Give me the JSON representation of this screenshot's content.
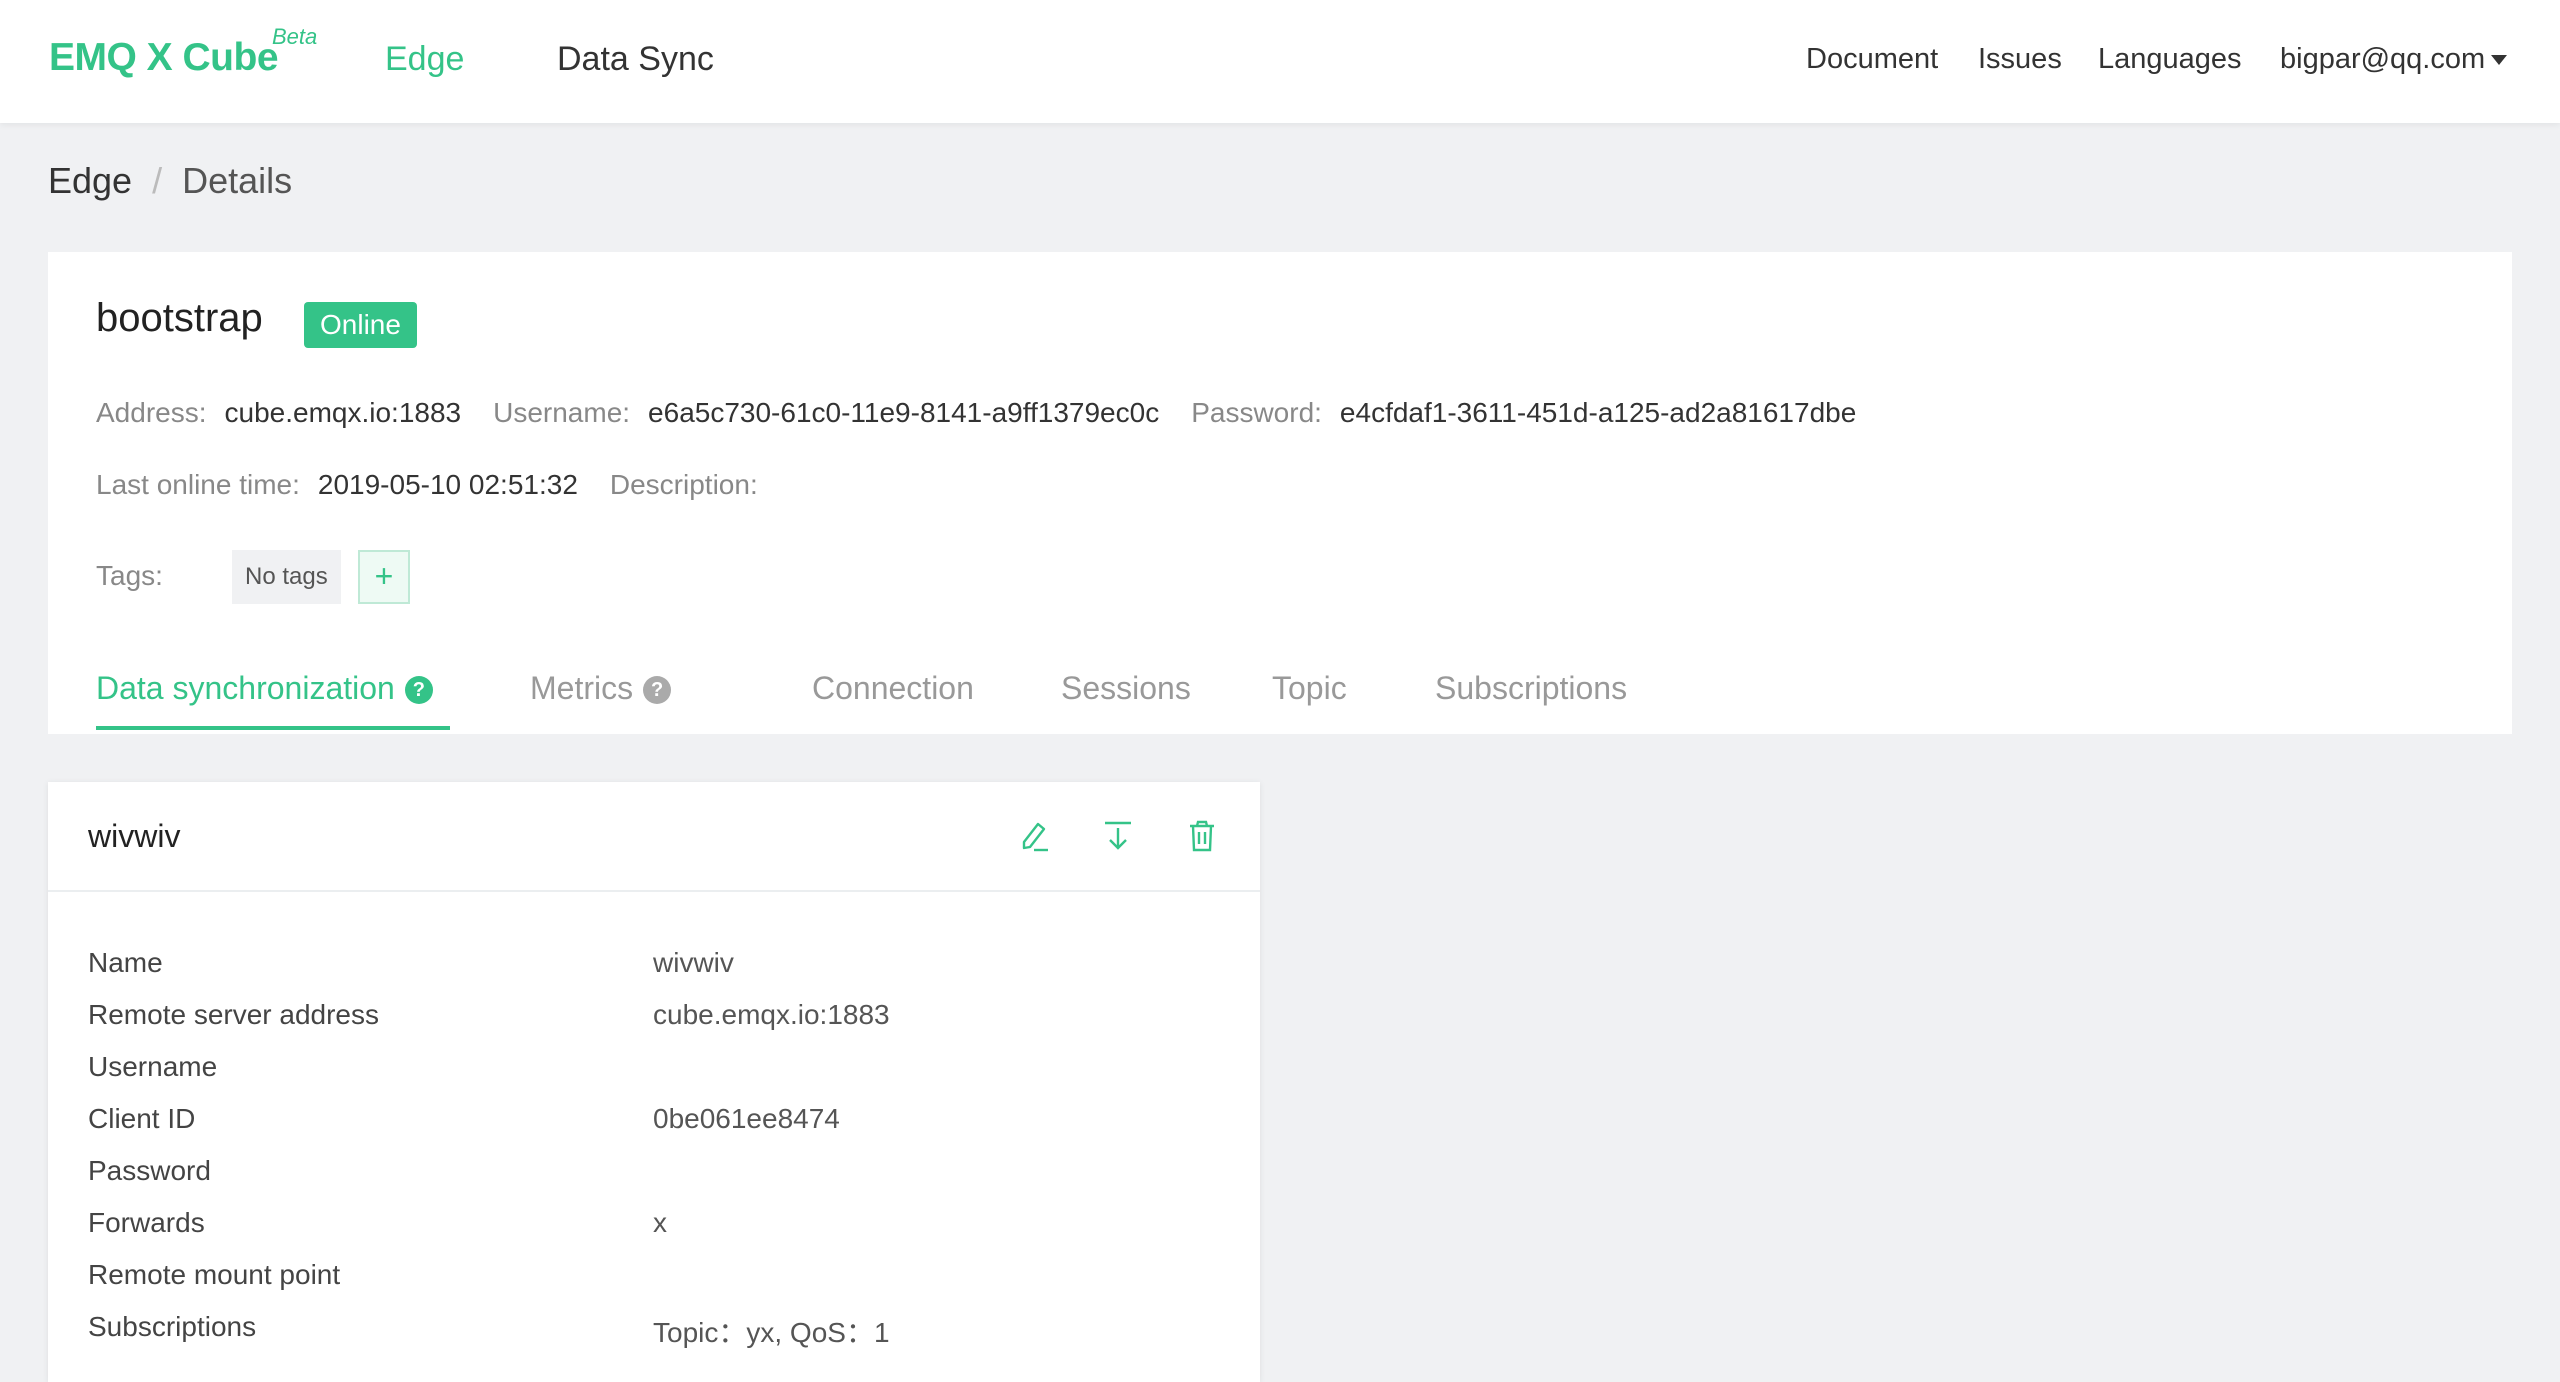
{
  "header": {
    "logo": "EMQ X Cube",
    "logo_badge": "Beta",
    "nav": [
      "Edge",
      "Data Sync"
    ],
    "links": [
      "Document",
      "Issues",
      "Languages"
    ],
    "user": "bigpar@qq.com"
  },
  "breadcrumb": {
    "root": "Edge",
    "separator": "/",
    "current": "Details"
  },
  "device": {
    "name": "bootstrap",
    "status": "Online",
    "address_label": "Address:",
    "address": "cube.emqx.io:1883",
    "username_label": "Username:",
    "username": "e6a5c730-61c0-11e9-8141-a9ff1379ec0c",
    "password_label": "Password:",
    "password": "e4cfdaf1-3611-451d-a125-ad2a81617dbe",
    "last_online_label": "Last online time:",
    "last_online": "2019-05-10 02:51:32",
    "description_label": "Description:",
    "description": "",
    "tags_label": "Tags:",
    "tags_empty": "No tags",
    "add_tag": "+"
  },
  "tabs": [
    "Data synchronization",
    "Metrics",
    "Connection",
    "Sessions",
    "Topic",
    "Subscriptions"
  ],
  "sync_card": {
    "title": "wivwiv",
    "rows": [
      {
        "label": "Name",
        "value": "wivwiv"
      },
      {
        "label": "Remote server address",
        "value": "cube.emqx.io:1883"
      },
      {
        "label": "Username",
        "value": ""
      },
      {
        "label": "Client ID",
        "value": "0be061ee8474"
      },
      {
        "label": "Password",
        "value": ""
      },
      {
        "label": "Forwards",
        "value": "x"
      },
      {
        "label": "Remote mount point",
        "value": ""
      },
      {
        "label": "Subscriptions",
        "value": "Topic：yx, QoS：1"
      }
    ]
  },
  "colors": {
    "accent": "#34c388",
    "background": "#f0f1f3"
  }
}
